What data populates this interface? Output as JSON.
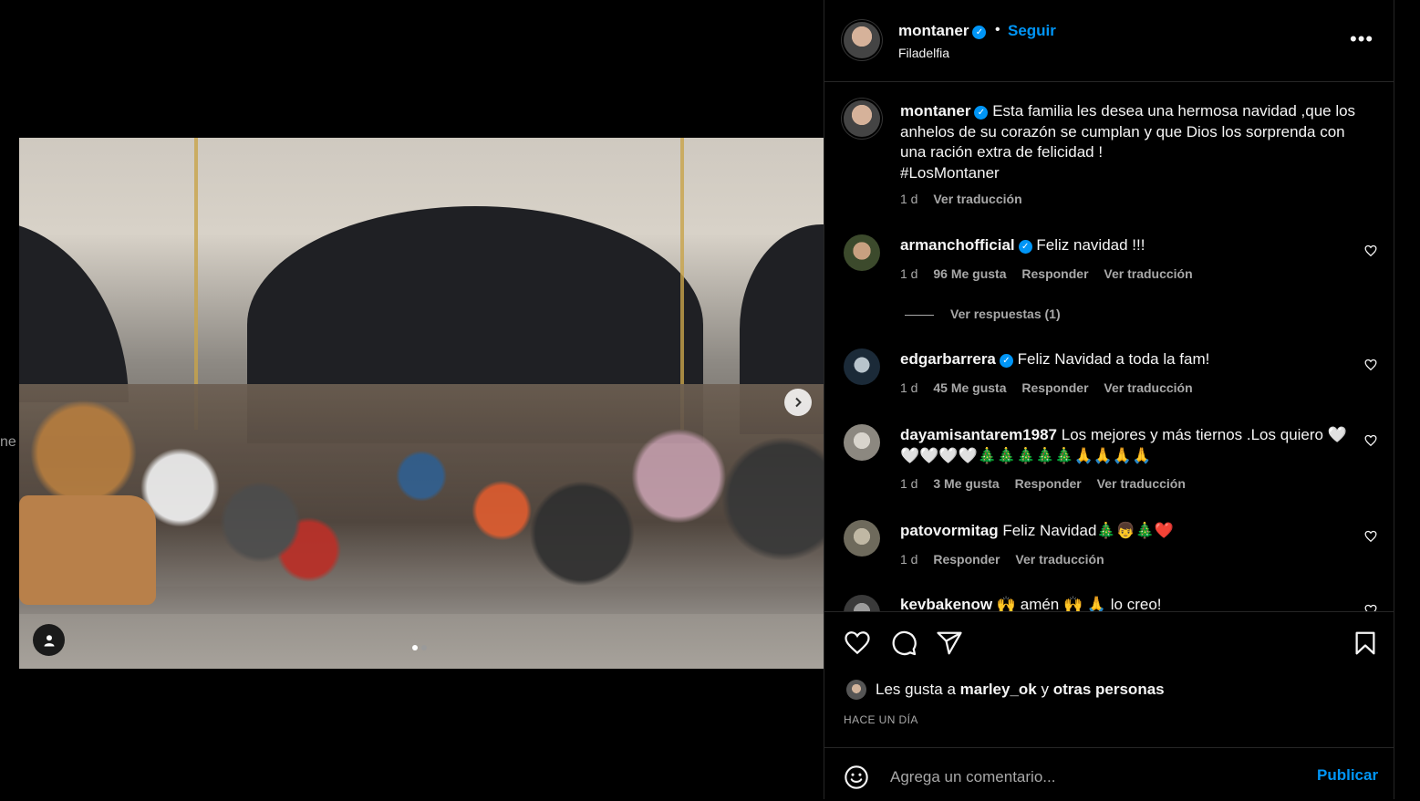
{
  "stage": {
    "peek_text": "ne",
    "carousel": {
      "current": 1,
      "total": 2
    },
    "next_icon": "chevron-right-icon",
    "tag_icon": "user-tag-icon"
  },
  "post_header": {
    "username": "montaner",
    "verified": true,
    "separator": "•",
    "follow_label": "Seguir",
    "location": "Filadelfia",
    "more_label": "•••"
  },
  "caption": {
    "username": "montaner",
    "text": "Esta familia les desea una hermosa navidad ,que los anhelos de su corazón se cumplan y que Dios los sorprenda con una ración extra de felicidad !",
    "hashtag": "#LosMontaner",
    "time": "1 d",
    "translate": "Ver traducción"
  },
  "comments": [
    {
      "username": "armanchofficial",
      "verified": true,
      "text": "Feliz navidad !!!",
      "time": "1 d",
      "likes": "96 Me gusta",
      "reply": "Responder",
      "translate": "Ver traducción",
      "view_replies": "Ver respuestas (1)"
    },
    {
      "username": "edgarbarrera",
      "verified": true,
      "text": "Feliz Navidad a toda la fam!",
      "time": "1 d",
      "likes": "45 Me gusta",
      "reply": "Responder",
      "translate": "Ver traducción"
    },
    {
      "username": "dayamisantarem1987",
      "verified": false,
      "text": "Los mejores y más tiernos .Los quiero 🤍🤍🤍🤍🤍🎄🎄🎄🎄🎄🙏🙏🙏🙏",
      "time": "1 d",
      "likes": "3 Me gusta",
      "reply": "Responder",
      "translate": "Ver traducción"
    },
    {
      "username": "patovormitag",
      "verified": false,
      "text": "Feliz Navidad🎄👦🎄❤️",
      "time": "1 d",
      "reply": "Responder",
      "translate": "Ver traducción"
    },
    {
      "username": "kevbakenow",
      "verified": false,
      "text": "🙌 amén 🙌 🙏 lo creo!"
    }
  ],
  "actions": {
    "like_icon": "heart-icon",
    "comment_icon": "comment-icon",
    "share_icon": "send-icon",
    "save_icon": "bookmark-icon",
    "likes_prefix": "Les gusta a",
    "likes_user": "marley_ok",
    "likes_and": "y",
    "likes_others": "otras personas",
    "when": "HACE UN DÍA"
  },
  "composer": {
    "emoji_icon": "emoji-icon",
    "placeholder": "Agrega un comentario...",
    "publish_label": "Publicar"
  },
  "colors": {
    "accent": "#0095f6",
    "background": "#000000",
    "muted_text": "#a8a8a8",
    "border": "#262626"
  }
}
